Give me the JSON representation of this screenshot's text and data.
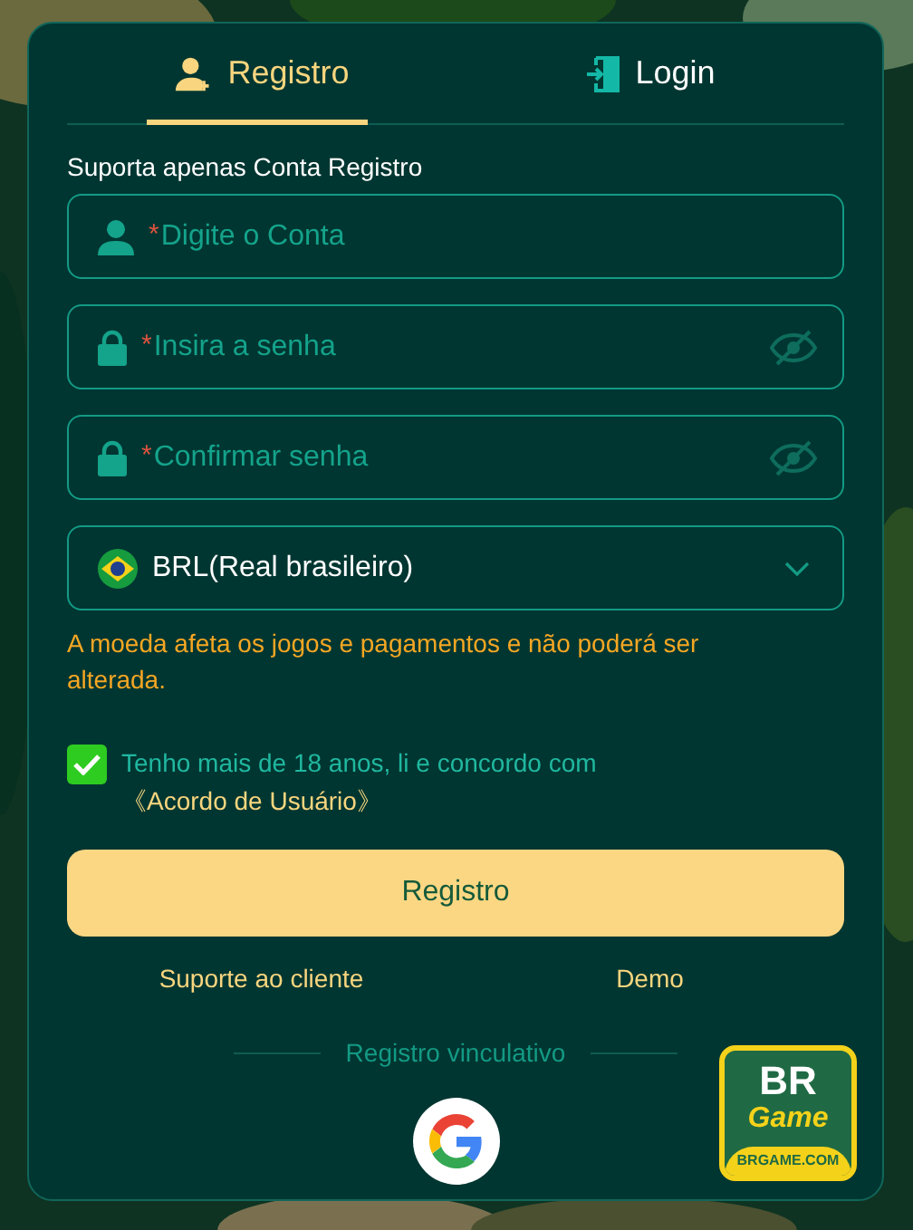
{
  "tabs": [
    {
      "label": "Registro",
      "kind": "register",
      "selected": true
    },
    {
      "label": "Login",
      "kind": "login",
      "selected": false
    }
  ],
  "subtitle": "Suporta apenas Conta Registro",
  "fields": [
    {
      "kind": "account",
      "required_mark": "*",
      "placeholder": "Digite o Conta"
    },
    {
      "kind": "password",
      "required_mark": "*",
      "placeholder": "Insira a senha"
    },
    {
      "kind": "password",
      "required_mark": "*",
      "placeholder": "Confirmar senha"
    }
  ],
  "currency": {
    "value": "BRL(Real brasileiro)",
    "expanded": false
  },
  "warning": "A moeda afeta os jogos e pagamentos e não poderá ser alterada.",
  "agreement": {
    "checked": true,
    "text": "Tenho mais de 18 anos, li e concordo com",
    "link": "《Acordo de Usuário》"
  },
  "submit": "Registro",
  "links": [
    "Suporte ao cliente",
    "Demo"
  ],
  "divider": "Registro vinculativo",
  "logo": {
    "top": "BR",
    "middle": "Game",
    "bottom": "BRGAME.COM"
  }
}
